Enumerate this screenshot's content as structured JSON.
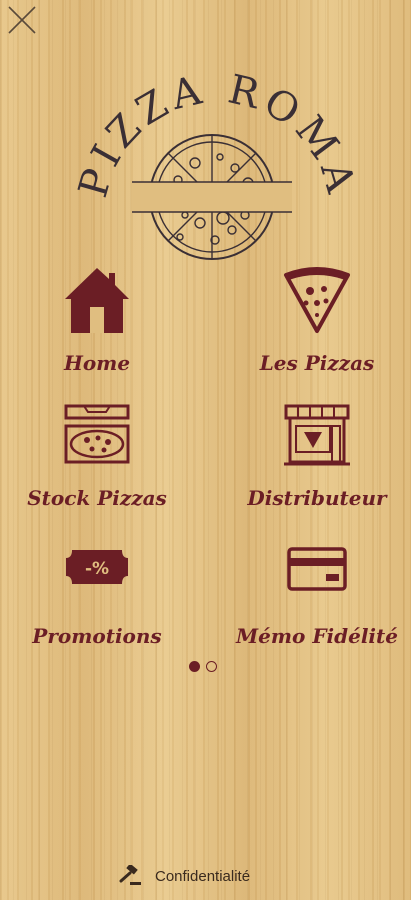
{
  "brand": {
    "name_line": "PIZZA ROMA",
    "color": "#6b1e25",
    "logo_color": "#3a2f35"
  },
  "menu": [
    {
      "label": "Home",
      "icon": "house-icon"
    },
    {
      "label": "Les Pizzas",
      "icon": "pizza-slice-icon"
    },
    {
      "label": "Stock Pizzas",
      "icon": "pizza-box-icon"
    },
    {
      "label": "Distributeur",
      "icon": "storefront-icon"
    },
    {
      "label": "Promotions",
      "icon": "discount-tag-icon",
      "tag_text": "-%"
    },
    {
      "label": "Mémo Fidélité",
      "icon": "loyalty-card-icon"
    }
  ],
  "pager": {
    "pages": 2,
    "current": 1
  },
  "footer": {
    "privacy_label": "Confidentialité",
    "icon": "gavel-icon"
  },
  "close": {
    "icon": "close-icon"
  }
}
